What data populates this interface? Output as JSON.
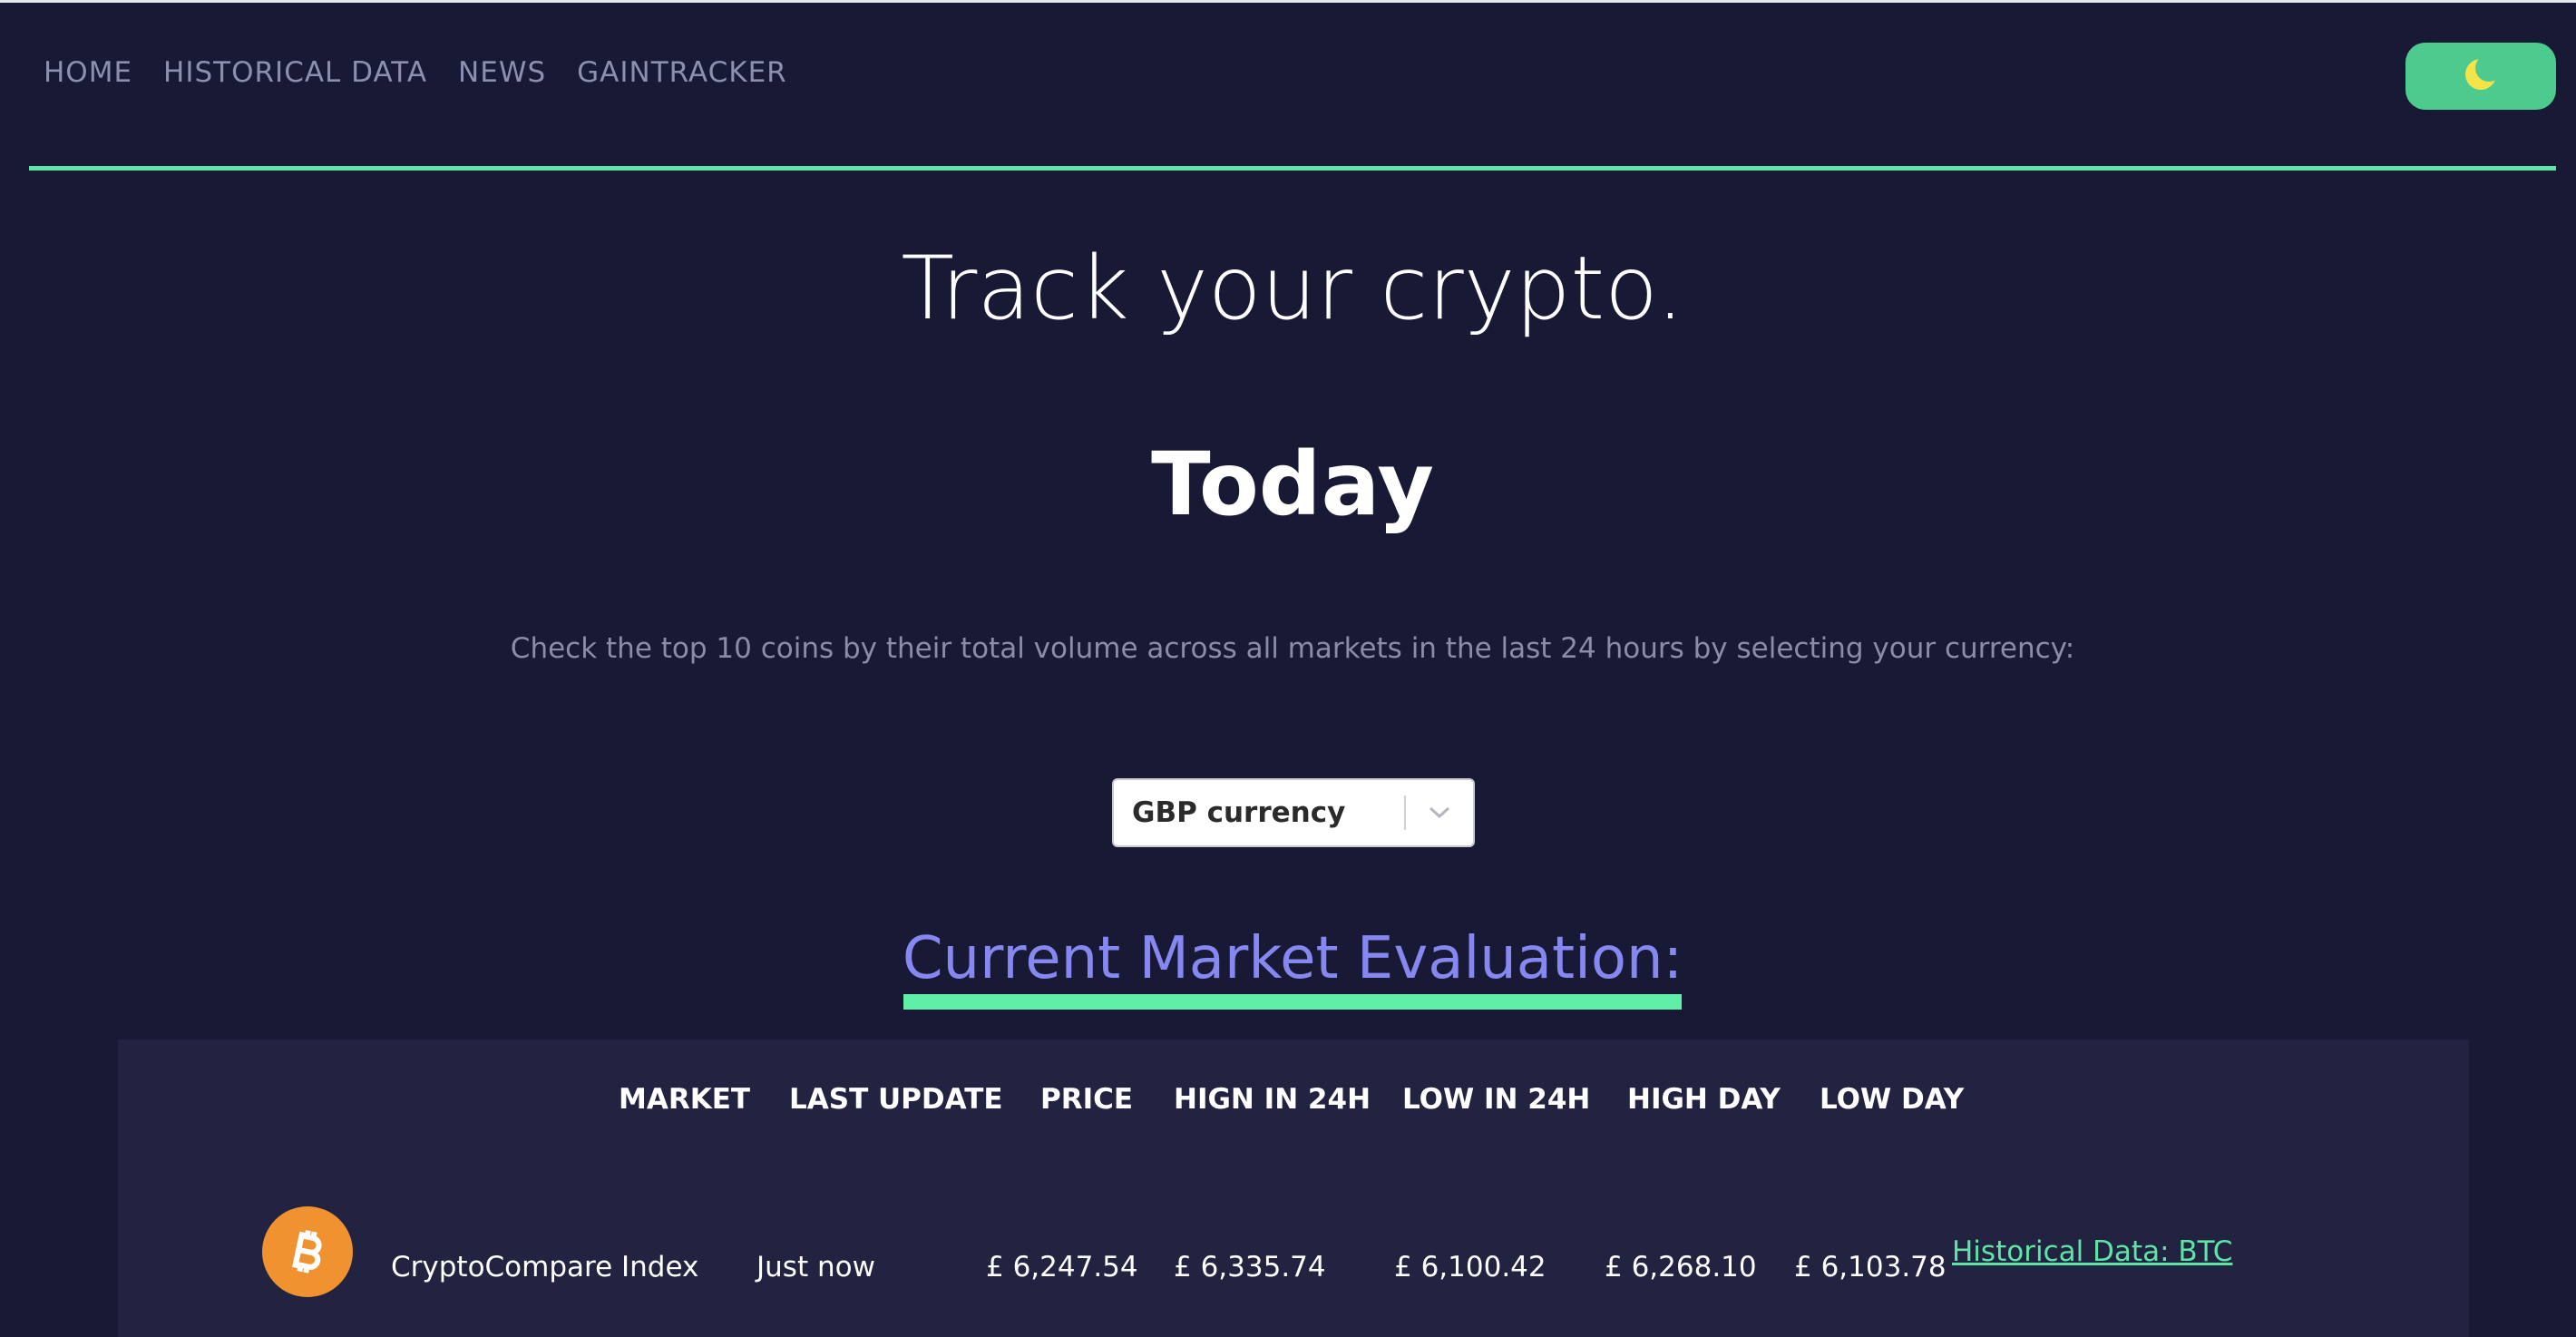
{
  "nav": {
    "items": [
      {
        "label": "HOME"
      },
      {
        "label": "HISTORICAL DATA"
      },
      {
        "label": "NEWS"
      },
      {
        "label": "GAINTRACKER"
      }
    ],
    "theme_toggle_icon": "moon-icon"
  },
  "hero": {
    "title": "Track your crypto.",
    "subtitle": "Today",
    "description": "Check the top 10 coins by their total volume across all markets in the last 24 hours by selecting your currency:"
  },
  "currency_select": {
    "value": "GBP currency"
  },
  "market": {
    "heading": "Current Market Evaluation:",
    "columns": [
      "MARKET",
      "LAST UPDATE",
      "PRICE",
      "HIGN IN 24H",
      "LOW IN 24H",
      "HIGH DAY",
      "LOW DAY"
    ],
    "rows": [
      {
        "icon": "bitcoin-icon",
        "market": "CryptoCompare Index",
        "last_update": "Just now",
        "price": "£ 6,247.54",
        "high_24h": "£ 6,335.74",
        "low_24h": "£ 6,100.42",
        "high_day": "£ 6,268.10",
        "low_day": "£ 6,103.78",
        "link": "Historical Data: BTC"
      }
    ]
  },
  "colors": {
    "background": "#181935",
    "accent_green": "#5fe3a7",
    "heading_purple": "#8787f2",
    "bitcoin_orange": "#f0922f",
    "moon_yellow": "#f5e34a"
  }
}
